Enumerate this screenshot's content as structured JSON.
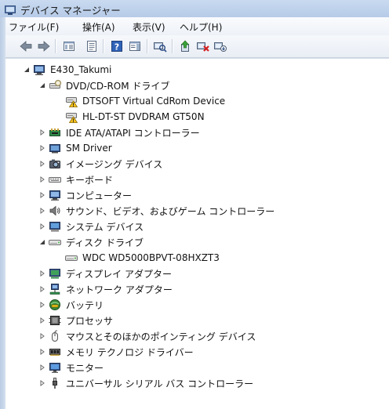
{
  "window": {
    "title": "デバイス マネージャー"
  },
  "menu": [
    {
      "label": "ファイル(F)"
    },
    {
      "label": "操作(A)"
    },
    {
      "label": "表示(V)"
    },
    {
      "label": "ヘルプ(H)"
    }
  ],
  "toolbar": [
    {
      "icon": "back-arrow-icon"
    },
    {
      "icon": "forward-arrow-icon"
    },
    {
      "icon": "console-tree-icon"
    },
    {
      "icon": "properties-icon"
    },
    {
      "icon": "help-icon"
    },
    {
      "icon": "action-pane-icon"
    },
    {
      "icon": "scan-hardware-icon"
    },
    {
      "icon": "update-driver-icon"
    },
    {
      "icon": "uninstall-icon"
    },
    {
      "icon": "disable-device-icon"
    }
  ],
  "tree": {
    "root": "E430_Takumi",
    "items": [
      {
        "label": "DVD/CD-ROM ドライブ",
        "level": 1,
        "expanded": true,
        "icon": "dvd-drive-icon"
      },
      {
        "label": "DTSOFT Virtual CdRom Device",
        "level": 2,
        "icon": "dvd-warning-icon"
      },
      {
        "label": "HL-DT-ST DVDRAM GT50N",
        "level": 2,
        "icon": "dvd-warning-icon"
      },
      {
        "label": "IDE ATA/ATAPI コントローラー",
        "level": 1,
        "expanded": false,
        "icon": "ide-controller-icon"
      },
      {
        "label": "SM Driver",
        "level": 1,
        "expanded": false,
        "icon": "sm-driver-icon"
      },
      {
        "label": "イメージング デバイス",
        "level": 1,
        "expanded": false,
        "icon": "camera-icon"
      },
      {
        "label": "キーボード",
        "level": 1,
        "expanded": false,
        "icon": "keyboard-icon"
      },
      {
        "label": "コンピューター",
        "level": 1,
        "expanded": false,
        "icon": "computer-icon"
      },
      {
        "label": "サウンド、ビデオ、およびゲーム コントローラー",
        "level": 1,
        "expanded": false,
        "icon": "speaker-icon"
      },
      {
        "label": "システム デバイス",
        "level": 1,
        "expanded": false,
        "icon": "system-device-icon"
      },
      {
        "label": "ディスク ドライブ",
        "level": 1,
        "expanded": true,
        "icon": "disk-drive-icon"
      },
      {
        "label": "WDC WD5000BPVT-08HXZT3",
        "level": 2,
        "icon": "disk-drive-icon"
      },
      {
        "label": "ディスプレイ アダプター",
        "level": 1,
        "expanded": false,
        "icon": "display-adapter-icon"
      },
      {
        "label": "ネットワーク アダプター",
        "level": 1,
        "expanded": false,
        "icon": "network-adapter-icon"
      },
      {
        "label": "バッテリ",
        "level": 1,
        "expanded": false,
        "icon": "battery-icon"
      },
      {
        "label": "プロセッサ",
        "level": 1,
        "expanded": false,
        "icon": "processor-icon"
      },
      {
        "label": "マウスとそのほかのポインティング デバイス",
        "level": 1,
        "expanded": false,
        "icon": "mouse-icon"
      },
      {
        "label": "メモリ テクノロジ ドライバー",
        "level": 1,
        "expanded": false,
        "icon": "memory-icon"
      },
      {
        "label": "モニター",
        "level": 1,
        "expanded": false,
        "icon": "monitor-icon"
      },
      {
        "label": "ユニバーサル シリアル バス コントローラー",
        "level": 1,
        "expanded": false,
        "icon": "usb-icon"
      }
    ]
  }
}
